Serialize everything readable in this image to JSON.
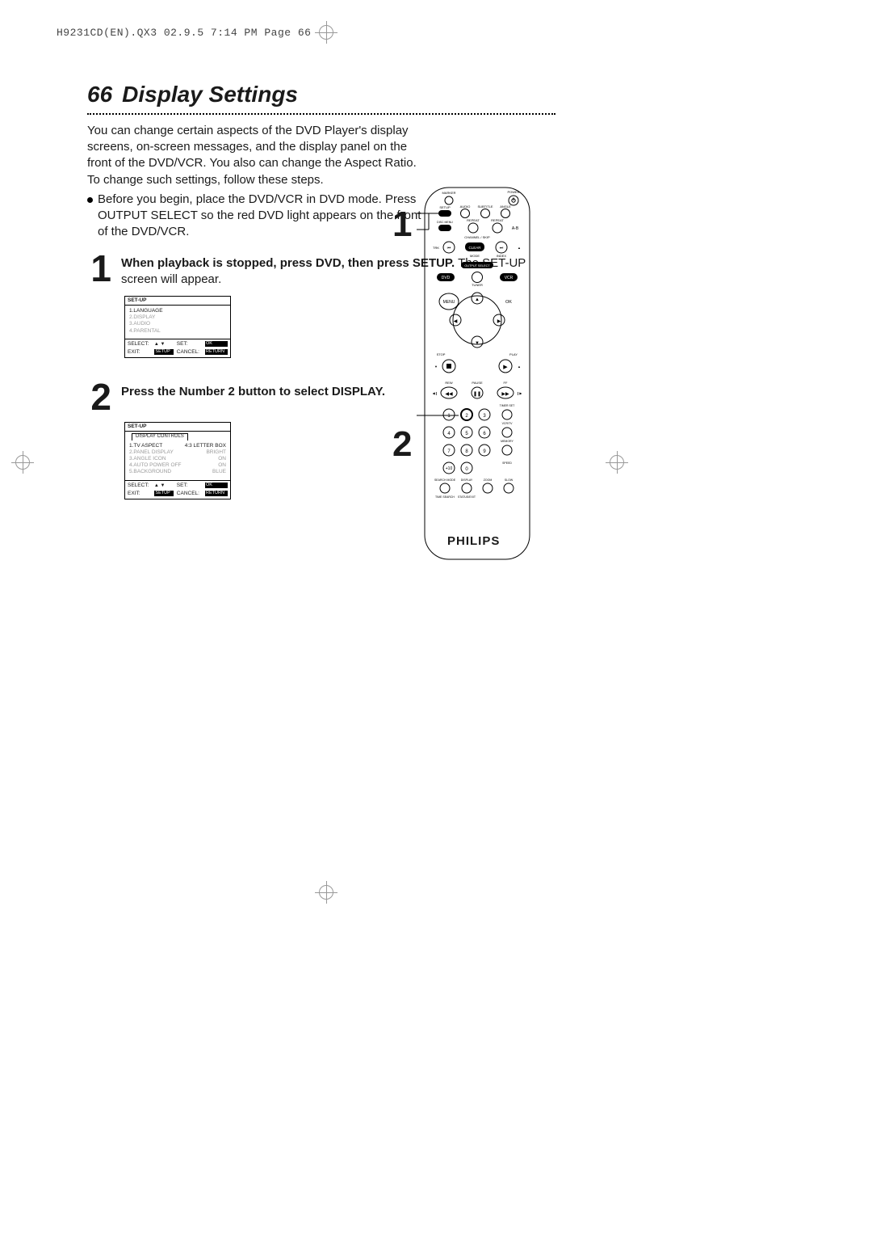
{
  "header_line": "H9231CD(EN).QX3  02.9.5 7:14 PM  Page 66",
  "page_number": "66",
  "title": "Display Settings",
  "intro": "You can change certain aspects of the DVD Player's display screens, on-screen messages, and the display panel on the front of the DVD/VCR. You also can change the Aspect Ratio. To change such settings, follow these steps.",
  "bullet": "Before you begin, place the DVD/VCR in DVD mode. Press OUTPUT SELECT so the red DVD light appears on the front of the DVD/VCR.",
  "step1_num": "1",
  "step1_text_bold": "When playback is stopped, press DVD, then press SETUP.",
  "step1_text_rest": " The SET-UP screen will appear.",
  "step2_num": "2",
  "step2_text_bold": "Press the Number 2 button to select DISPLAY.",
  "osd1": {
    "title": "SET-UP",
    "items": [
      "1.LANGUAGE",
      "2.DISPLAY",
      "3.AUDIO",
      "4.PARENTAL"
    ],
    "footer": {
      "select": "SELECT:",
      "arrows": "▲ ▼",
      "set": "SET:",
      "ok": "OK",
      "exit": "EXIT:",
      "setup": "SETUP",
      "cancel": "CANCEL:",
      "return": "RETURN"
    }
  },
  "osd2": {
    "title": "SET-UP",
    "tab": "DISPLAY CONTROLS",
    "items": [
      {
        "l": "1.TV ASPECT",
        "r": "4:3  LETTER BOX",
        "dim": false
      },
      {
        "l": "2.PANEL DISPLAY",
        "r": "BRIGHT",
        "dim": true
      },
      {
        "l": "3.ANGLE ICON",
        "r": "ON",
        "dim": true
      },
      {
        "l": "4.AUTO POWER OFF",
        "r": "ON",
        "dim": true
      },
      {
        "l": "5.BACKGROUND",
        "r": "BLUE",
        "dim": true
      }
    ],
    "footer": {
      "select": "SELECT:",
      "arrows": "▲ ▼",
      "set": "SET:",
      "ok": "OK",
      "exit": "EXIT:",
      "setup": "SETUP",
      "cancel": "CANCEL:",
      "return": "RETURN"
    }
  },
  "remote": {
    "brand": "PHILIPS",
    "callout1": "1",
    "callout2": "2",
    "labels": {
      "power": "POWER",
      "marker": "MARKER",
      "setup": "SETUP",
      "audio": "AUDIO",
      "subtitle": "SUBTITLE",
      "angle": "ANGLE",
      "discmenu": "DISC MENU",
      "repeat": "REPEAT",
      "repeat_ab": "REPEAT",
      "channel_skip": "CHANNEL / SKIP",
      "trk": "TRK",
      "clear": "CLEAR",
      "mode": "MODE",
      "index": "INDEX",
      "output_select": "OUTPUT SELECT",
      "dvd": "DVD",
      "tuner": "TUNER",
      "vcr": "VCR",
      "menu": "MENU",
      "ok": "OK",
      "stop": "STOP",
      "play": "PLAY",
      "rew": "REW",
      "pause": "PAUSE",
      "ff": "FF",
      "timer_set": "TIMER SET",
      "vcr_tv": "VCR/TV",
      "memory": "MEMORY",
      "speed": "SPEED",
      "search_mode": "SEARCH MODE",
      "display": "DISPLAY",
      "zoom": "ZOOM",
      "slow": "SLOW",
      "time_search": "TIME SEARCH",
      "status_exit": "STATUS/EXIT",
      "a_b": "A-B",
      "plus10": "+10",
      "nums": "1 2 3 4 5 6 7 8 9 0"
    }
  }
}
